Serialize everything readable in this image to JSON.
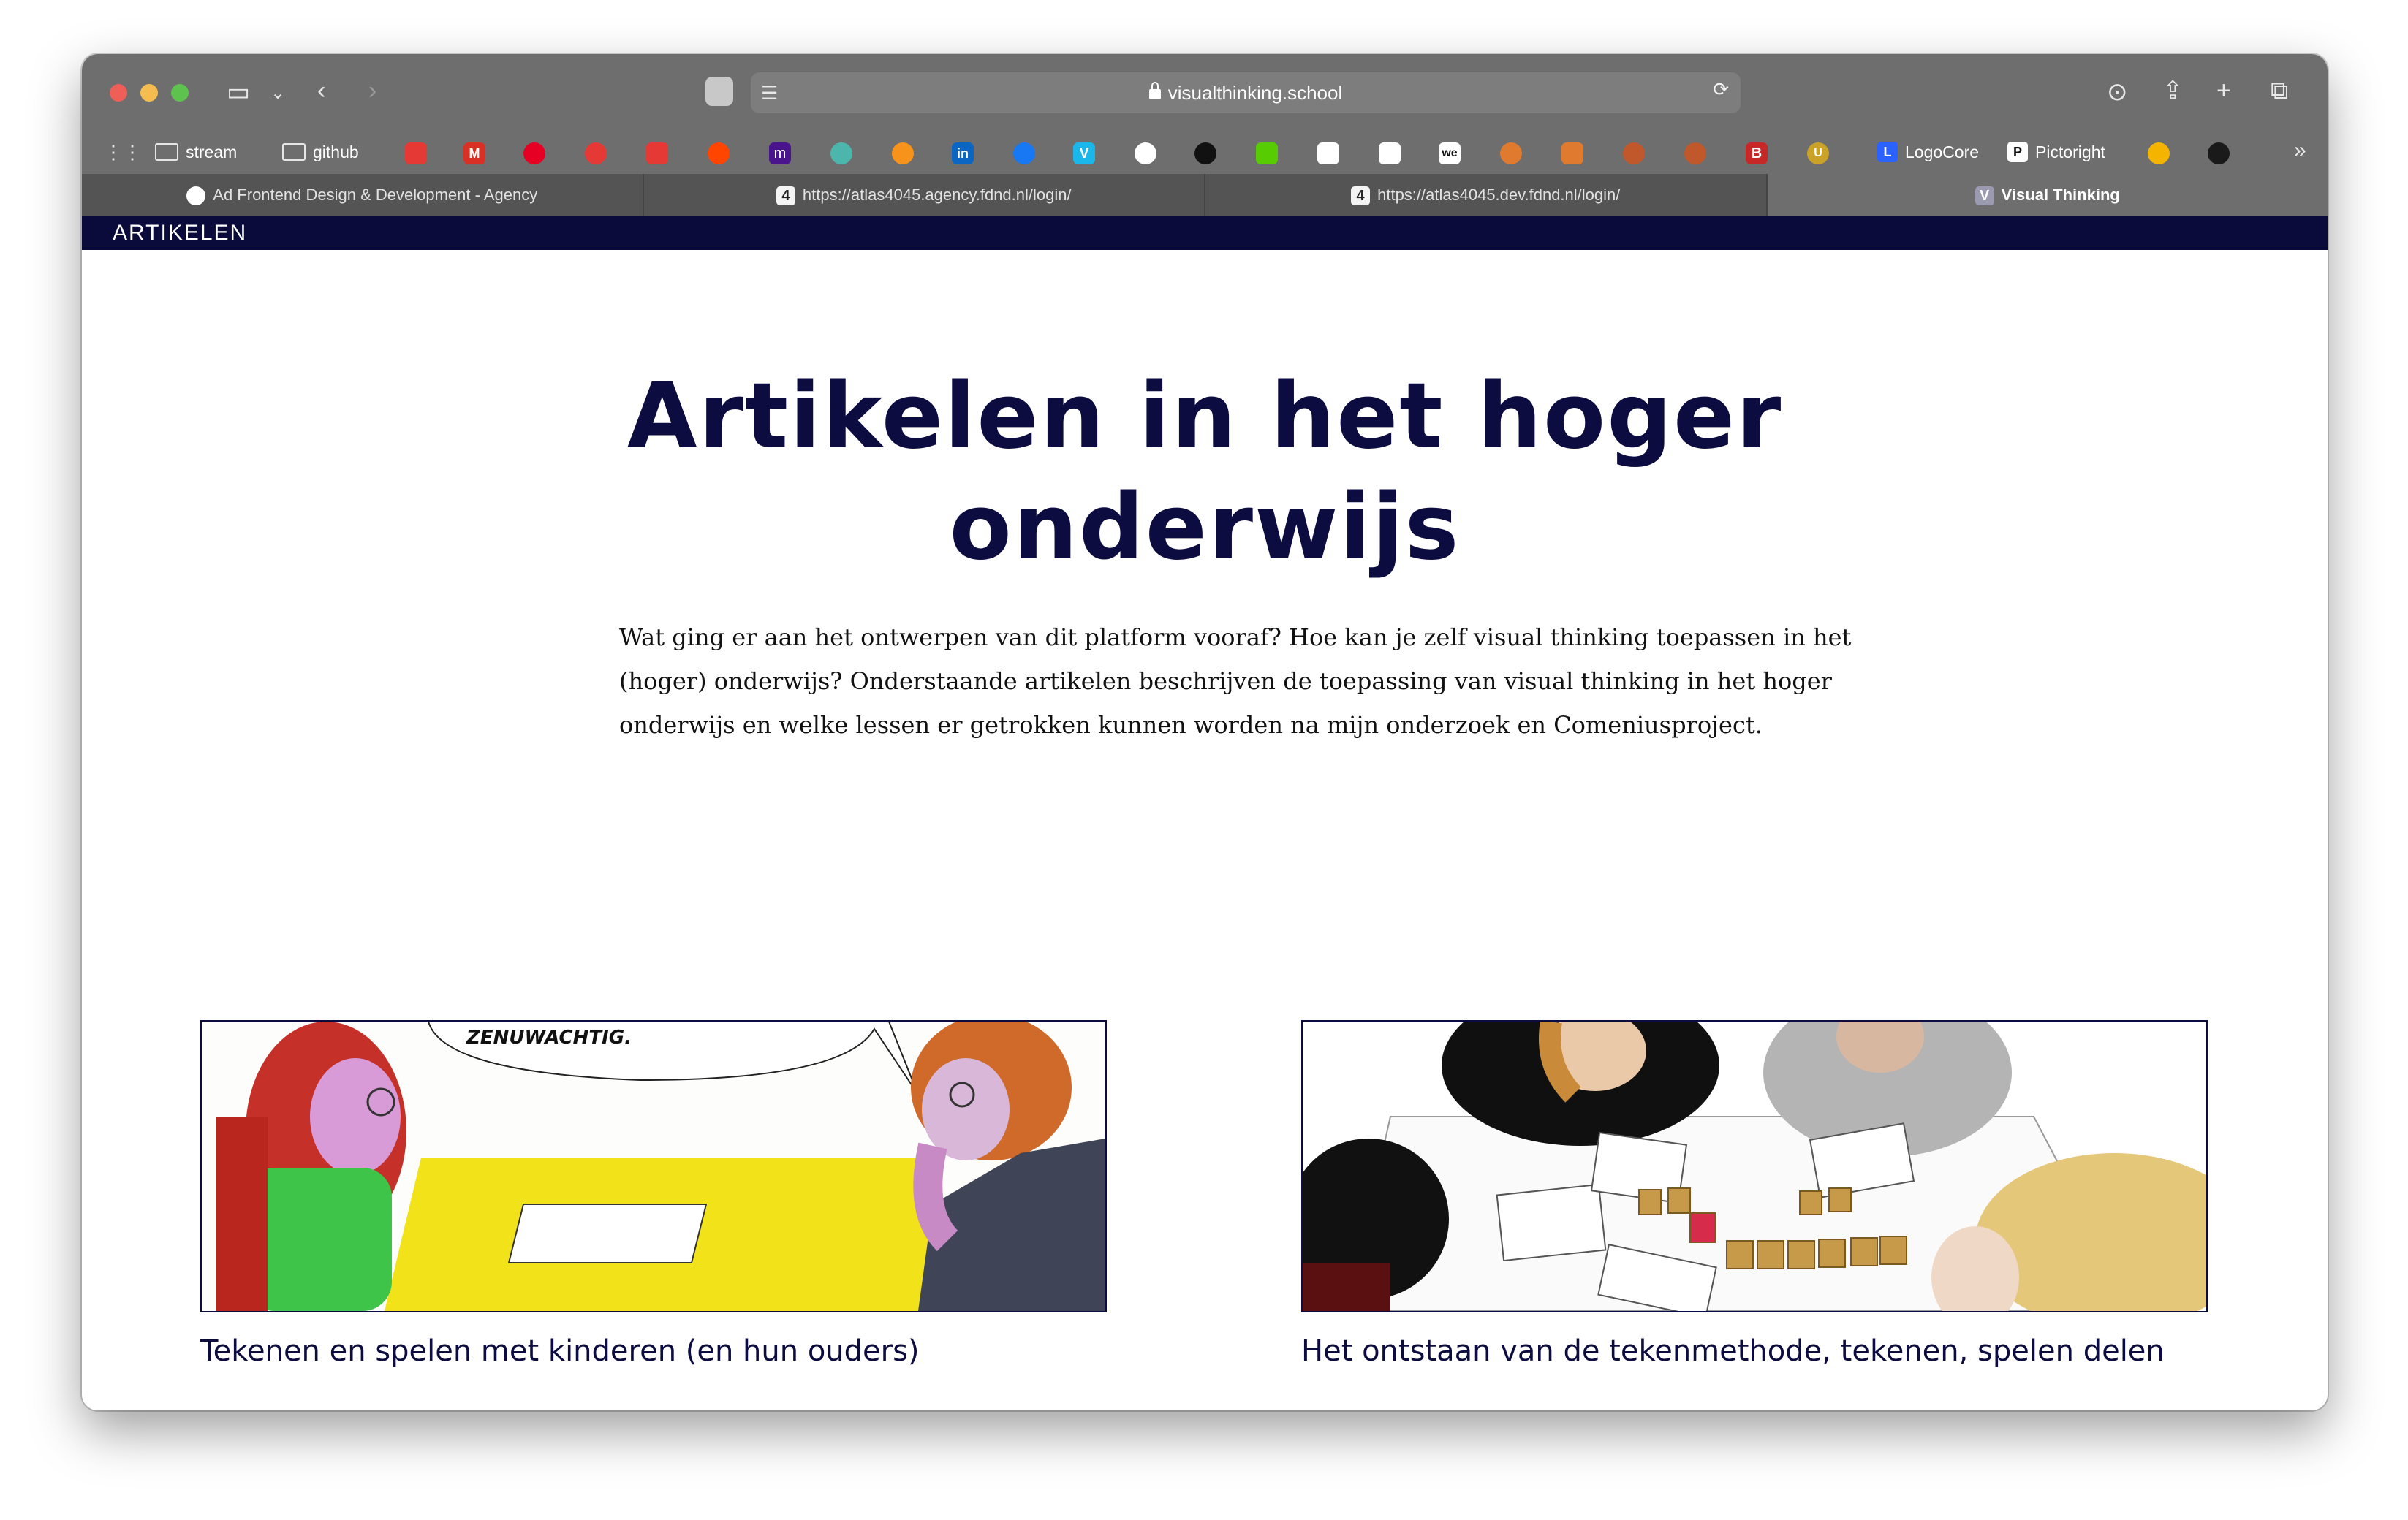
{
  "browser": {
    "url": "visualthinking.school",
    "bookmarks": [
      {
        "label": "stream"
      },
      {
        "label": "github"
      },
      {
        "label": "LogoCore"
      },
      {
        "label": "Pictoright"
      }
    ],
    "tabs": [
      {
        "label": "Ad Frontend Design & Development - Agency"
      },
      {
        "label": "https://atlas4045.agency.fdnd.nl/login/"
      },
      {
        "label": "https://atlas4045.dev.fdnd.nl/login/"
      },
      {
        "label": "Visual Thinking",
        "active": true
      }
    ],
    "tab_icon_text": [
      "4",
      "4",
      "V"
    ],
    "bookmark_icon_text": [
      "M",
      "m",
      "in",
      "V",
      "we",
      "B",
      "U",
      "L",
      "P"
    ]
  },
  "page": {
    "nav_label": "ARTIKELEN",
    "heading_line1": "Artikelen in het hoger",
    "heading_line2": "onderwijs",
    "intro": "Wat ging er aan het ontwerpen van dit platform vooraf? Hoe kan je zelf visual thinking toepassen in het (hoger) onderwijs? Onderstaande artikelen beschrijven de toepassing van visual thinking in het hoger onderwijs en welke lessen er getrokken kunnen worden na mijn onderzoek en Comeniusproject.",
    "articles": [
      {
        "title": "Tekenen en spelen met kinderen (en hun ouders)",
        "illustration_text": "ZENUWACHTIG."
      },
      {
        "title": "Het ontstaan van de tekenmethode, tekenen, spelen delen"
      }
    ]
  },
  "colors": {
    "navy": "#0b0b3b",
    "browser_chrome": "#6e6e6e"
  }
}
